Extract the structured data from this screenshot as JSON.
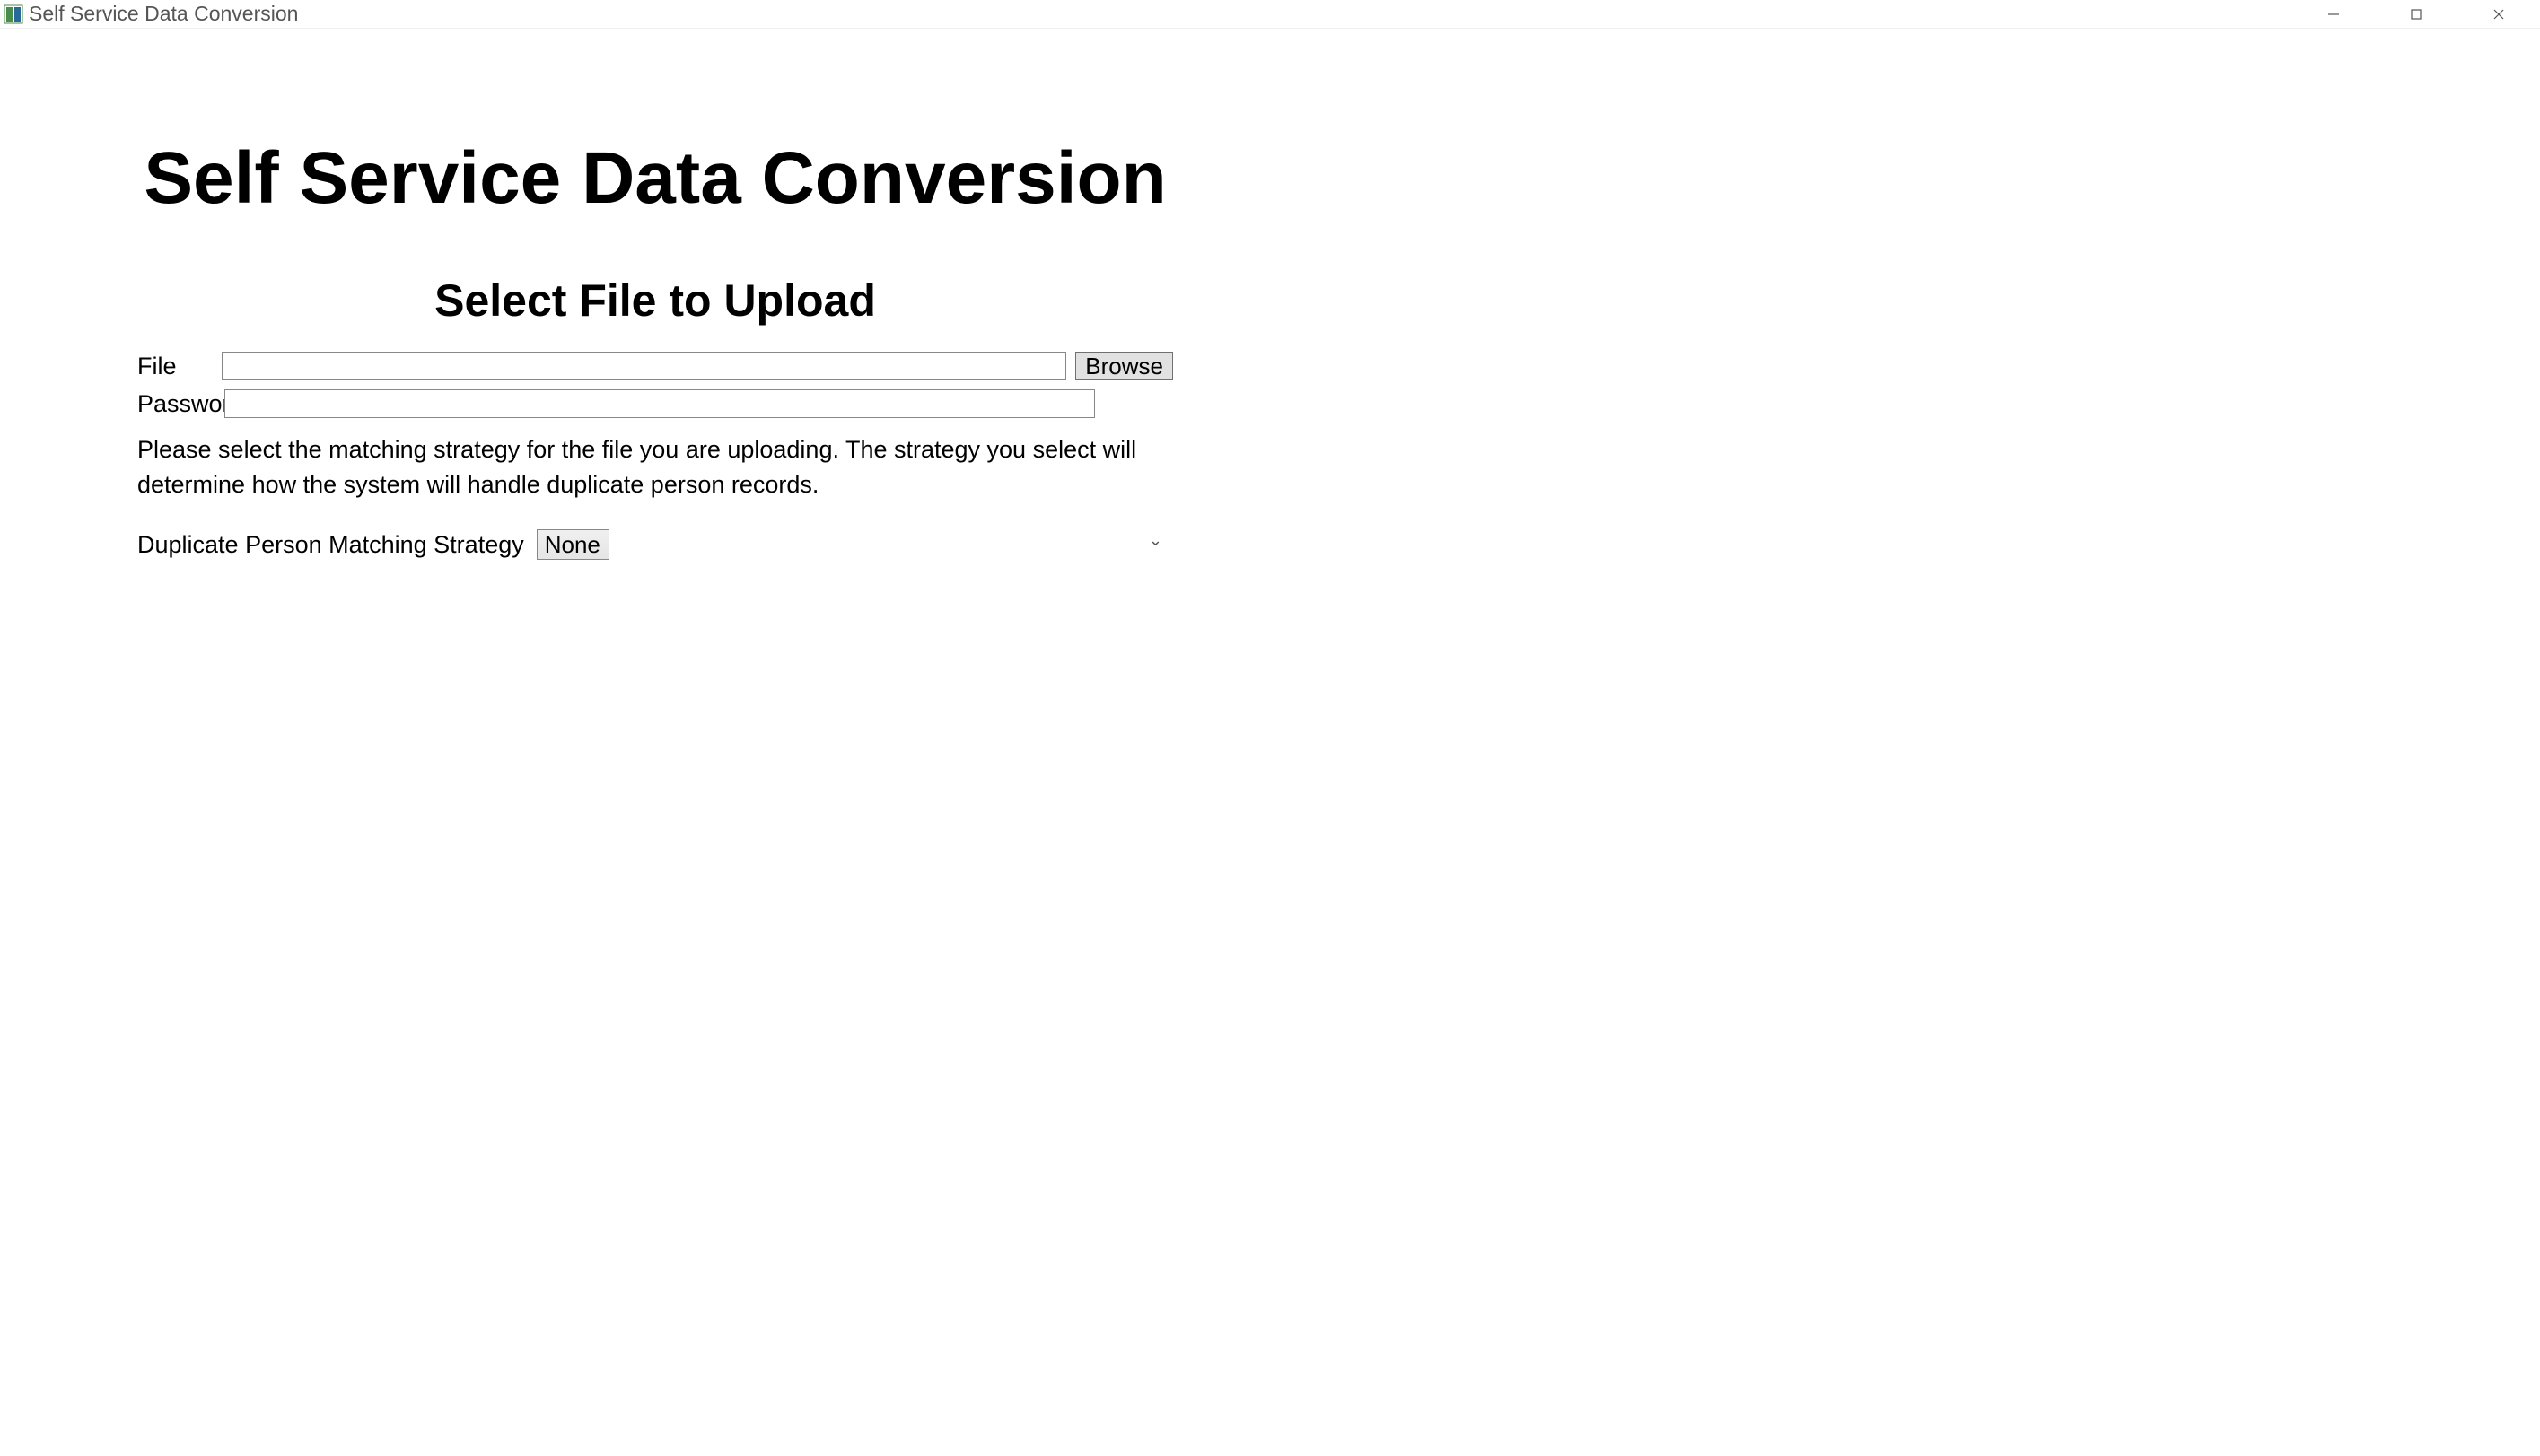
{
  "window": {
    "title": "Self Service Data Conversion"
  },
  "main": {
    "heading": "Self Service Data Conversion",
    "subheading": "Select File to Upload"
  },
  "form": {
    "file_label": "File",
    "file_value": "",
    "password_label": "Password",
    "password_value": "",
    "browse_label": "Browse",
    "helper_text": "Please select the matching strategy for the file you are uploading. The strategy you select will determine how the system will handle duplicate person records.",
    "strategy_label": "Duplicate Person Matching Strategy",
    "strategy_selected": "None"
  }
}
